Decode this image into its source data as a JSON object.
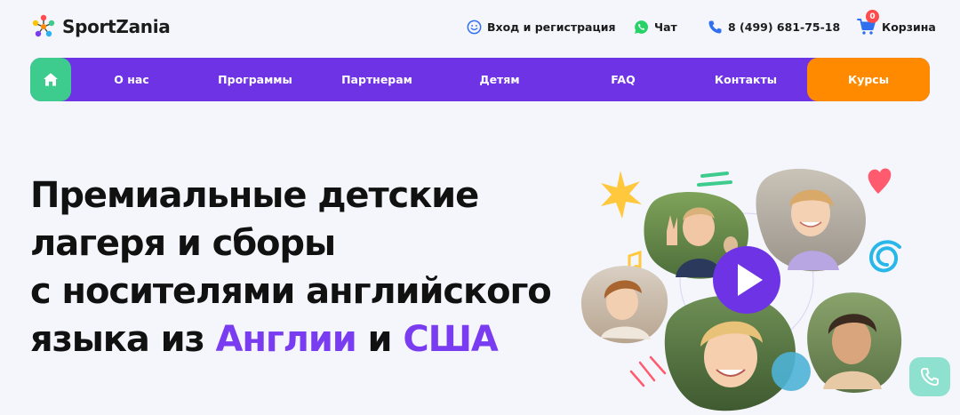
{
  "header": {
    "logo_text": "SportZania",
    "login_label": "Вход и регистрация",
    "chat_label": "Чат",
    "phone_label": "8 (499) 681-75-18",
    "cart_label": "Корзина",
    "cart_count": "0"
  },
  "nav": {
    "items": [
      {
        "label": "О нас"
      },
      {
        "label": "Программы"
      },
      {
        "label": "Партнерам"
      },
      {
        "label": "Детям"
      },
      {
        "label": "FAQ"
      },
      {
        "label": "Контакты"
      }
    ],
    "courses_label": "Курсы"
  },
  "hero": {
    "line1": "Премиальные детские",
    "line2": "лагеря и сборы",
    "line3": "с носителями английского",
    "line4_prefix": "языка из ",
    "line4_accent1": "Англии",
    "line4_mid": " и ",
    "line4_accent2": "США"
  },
  "colors": {
    "nav_purple": "#6f33e6",
    "home_green": "#3ecb8e",
    "courses_orange": "#ff8a00",
    "accent_purple": "#7a3cf0",
    "cart_badge_red": "#ff4b4b"
  },
  "icons": {
    "home": "home-icon",
    "login": "smile-icon",
    "chat": "whatsapp-icon",
    "phone": "phone-icon",
    "cart": "cart-icon",
    "play": "play-icon",
    "call": "phone-call-icon"
  }
}
